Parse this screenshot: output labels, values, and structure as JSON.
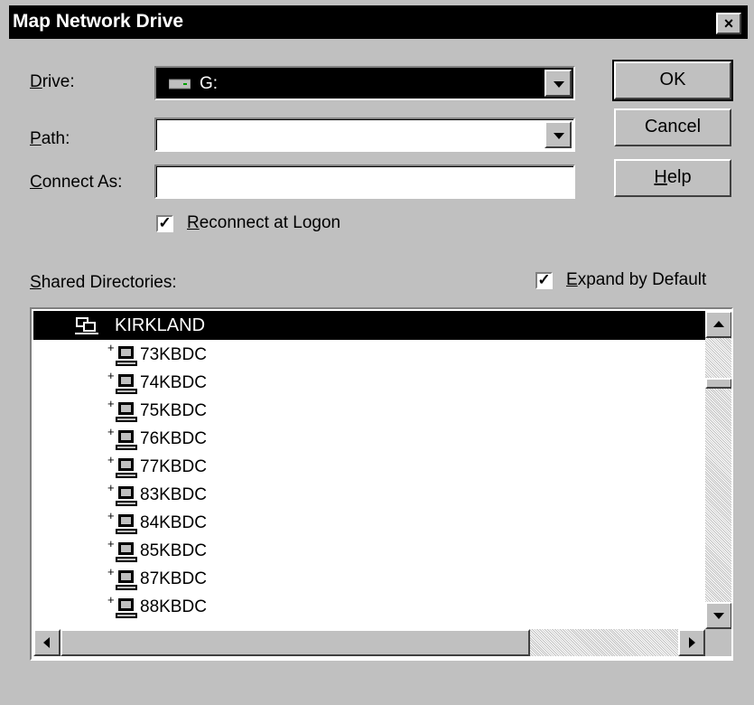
{
  "window": {
    "title": "Map Network Drive",
    "close_glyph": "×"
  },
  "form": {
    "drive_label": "Drive:",
    "drive_value": "G:",
    "path_label": "Path:",
    "path_value": "",
    "connect_as_label": "Connect As:",
    "connect_as_value": "",
    "reconnect_label": "Reconnect at Logon",
    "reconnect_checked": true
  },
  "buttons": {
    "ok": "OK",
    "cancel": "Cancel",
    "help": "Help"
  },
  "shared": {
    "label": "Shared Directories:",
    "expand_label": "Expand by Default",
    "expand_checked": true,
    "root": "KIRKLAND",
    "items": [
      "73KBDC",
      "74KBDC",
      "75KBDC",
      "76KBDC",
      "77KBDC",
      "83KBDC",
      "84KBDC",
      "85KBDC",
      "87KBDC",
      "88KBDC"
    ]
  },
  "icons": {
    "drive": "network-drive-icon",
    "root": "network-workgroup-icon",
    "item": "computer-icon"
  }
}
